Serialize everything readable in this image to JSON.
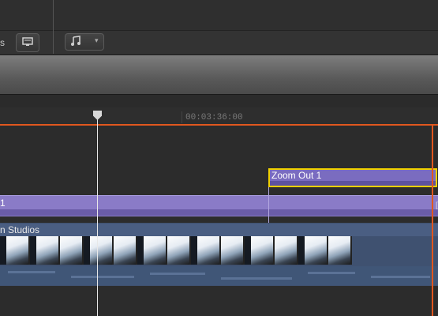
{
  "toolbar": {
    "partial_label": "s",
    "audio_icon": "music-note-icon",
    "view_icon": "monitor-icon",
    "chevron": "▾"
  },
  "ruler": {
    "timecode": "00:03:36:00"
  },
  "clips": {
    "title_clip": "Zoom Out 1",
    "storyline_clip": "1",
    "video_clip": "n Studios",
    "end_marker": "["
  },
  "colors": {
    "accent_orange": "#e0571f",
    "selection_yellow": "#f0d000",
    "title_purple": "#7a6cc0",
    "video_blue": "#3f5170"
  }
}
